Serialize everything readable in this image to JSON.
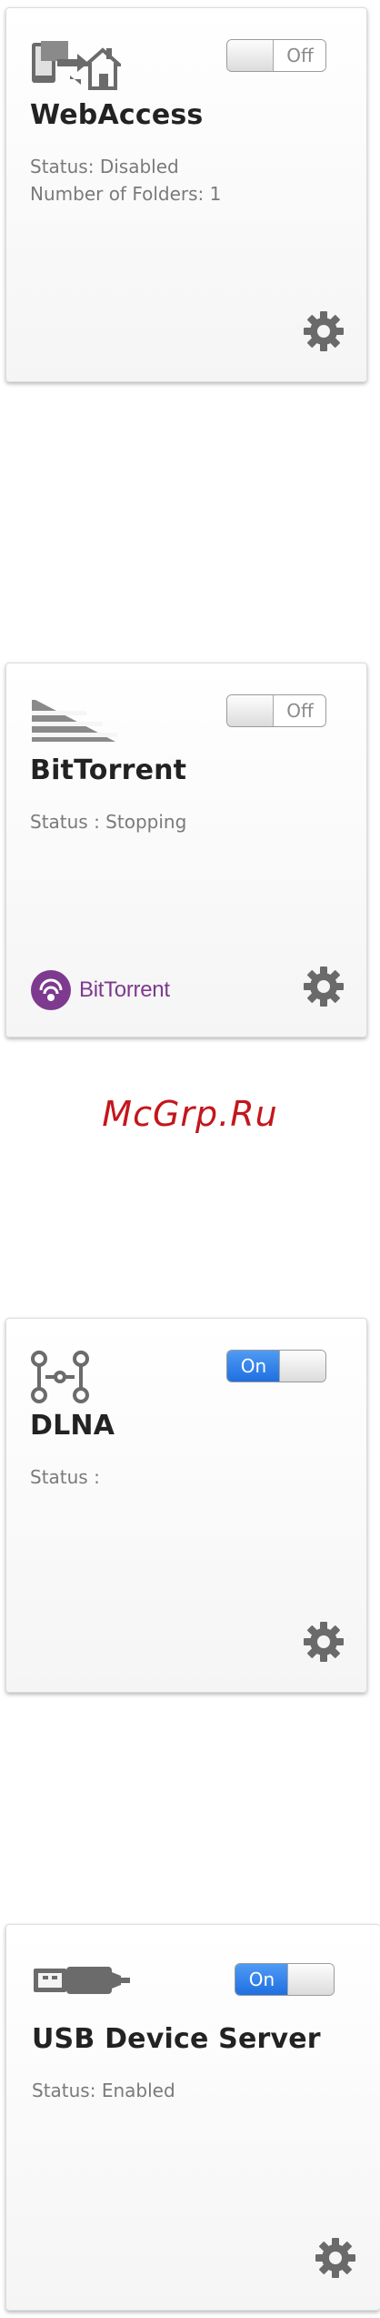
{
  "cards": [
    {
      "title": "WebAccess",
      "toggle": "Off",
      "status": "Status: Disabled",
      "folders": "Number of Folders: 1",
      "icon": "webaccess-icon"
    },
    {
      "title": "BitTorrent",
      "toggle": "Off",
      "status": "Status : Stopping",
      "brand": "BitTorrent",
      "icon": "bittorrent-icon"
    },
    {
      "title": "DLNA",
      "toggle": "On",
      "status": "Status :",
      "icon": "dlna-icon"
    },
    {
      "title": "USB Device Server",
      "toggle": "On",
      "status": "Status: Enabled",
      "icon": "usb-icon"
    }
  ],
  "watermark": "McGrp.Ru",
  "colors": {
    "toggle_on": "#2f7fe8",
    "title": "#222222",
    "status": "#7a7a7a",
    "watermark": "#c4161c",
    "bittorrent_brand": "#7e3a8e"
  }
}
